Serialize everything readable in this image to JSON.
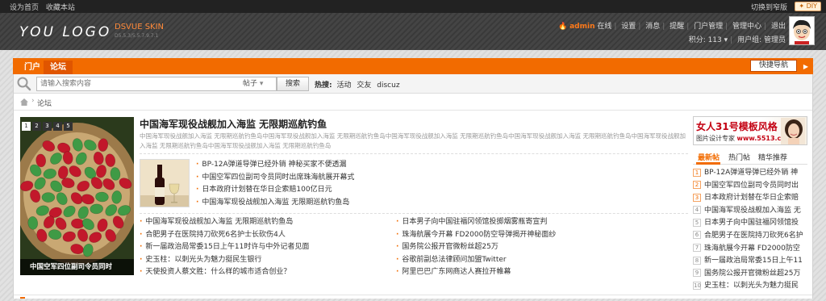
{
  "topbar": {
    "links": [
      "设为首页",
      "收藏本站"
    ],
    "switch_label": "切换到窄版",
    "diy_label": "DIY",
    "diy_icon": "star-icon"
  },
  "header": {
    "logo_text": "YOU LOGO",
    "skin_name": "DSVUE SKIN",
    "skin_sub": "D5.5.3/5.5.7.9.7.1"
  },
  "user": {
    "flame_icon": "flame-icon",
    "name": "admin",
    "status": "在线",
    "links": [
      "设置",
      "消息",
      "提醒",
      "门户管理",
      "管理中心",
      "退出"
    ],
    "credits_label": "积分: 113",
    "group_label": "用户组: 管理员"
  },
  "nav": {
    "tabs": [
      "门户",
      "论坛"
    ],
    "active_tab": "论坛",
    "quick_nav_label": "快捷导航"
  },
  "search": {
    "placeholder": "请输入搜索内容",
    "type_label": "帖子",
    "button_label": "搜索",
    "hot_label": "热搜:",
    "hot_words": [
      "活动",
      "交友",
      "discuz"
    ]
  },
  "breadcrumb": {
    "current": "论坛"
  },
  "slideshow": {
    "pages": [
      "1",
      "2",
      "3",
      "4",
      "5"
    ],
    "active_page": "1",
    "caption": "中国空军四位副司令员同时"
  },
  "headline": {
    "title": "中国海军现役战舰加入海监 无限期巡航钓鱼",
    "summary": "中国海军现役战舰加入海监 无限期巡航钓鱼岛中国海军现役战舰加入海监 无限期巡航钓鱼岛中国海军现役战舰加入海监 无限期巡航钓鱼岛中国海军现役战舰加入海监 无限期巡航钓鱼岛中国海军现役战舰加入海监 无限期巡航钓鱼岛中国海军现役战舰加入海监 无限期巡航钓鱼岛"
  },
  "thumb_news": [
    "BP-12A弹道导弹已经外销 神秘买家不便透漏",
    "中国空军四位副司令员同时出席珠海航展开幕式",
    "日本政府计划替在华日企索赔100亿日元",
    "中国海军现役战舰加入海监 无限期巡航钓鱼岛"
  ],
  "news_left": [
    "中国海军现役战舰加入海监 无限期巡航钓鱼岛",
    "合肥男子在医院持刀砍死6名护士长砍伤4人",
    "新一届政治局常委15日上午11时许与中外记者见面",
    "史玉柱：以刺光头为魅力挺民生银行",
    "天使投资人蔡文胜：什么样的城市适合创业？"
  ],
  "news_right": [
    "日本男子向中国驻福冈领馆投掷烟雾瓶寄宣判",
    "珠海航展今开幕 FD2000防空导弹揭开神秘面纱",
    "国务院公报开官微粉丝超25万",
    "谷歌前副总法律顾问加盟Twitter",
    "阿里巴巴广东网商达人赛拉开帷幕"
  ],
  "ad": {
    "title": "女人31号模板风格",
    "subtitle_prefix": "图片设计专家",
    "subtitle_link": "www.5513.cn"
  },
  "side_tabs": [
    "最新帖",
    "热门帖",
    "精华推荐"
  ],
  "side_active_tab": "最新帖",
  "rank_list": [
    {
      "n": "1",
      "text": "BP-12A弹道导弹已经外销 神"
    },
    {
      "n": "2",
      "text": "中国空军四位副司令员同时出"
    },
    {
      "n": "3",
      "text": "日本政府计划替在华日企索赔"
    },
    {
      "n": "4",
      "text": "中国海军现役战舰加入海监 无"
    },
    {
      "n": "5",
      "text": "日本男子向中国驻福冈领馆投"
    },
    {
      "n": "6",
      "text": "合肥男子在医院持刀砍死6名护"
    },
    {
      "n": "7",
      "text": "珠海航展今开幕 FD2000防空"
    },
    {
      "n": "8",
      "text": "新一届政治局常委15日上午11"
    },
    {
      "n": "9",
      "text": "国务院公报开官微粉丝超25万"
    },
    {
      "n": "10",
      "text": "史玉柱：以刺光头为魅力挺民"
    }
  ],
  "colors": {
    "accent": "#f26b00",
    "header_bg": "#3f3f3f",
    "topbar_bg": "#222222"
  }
}
